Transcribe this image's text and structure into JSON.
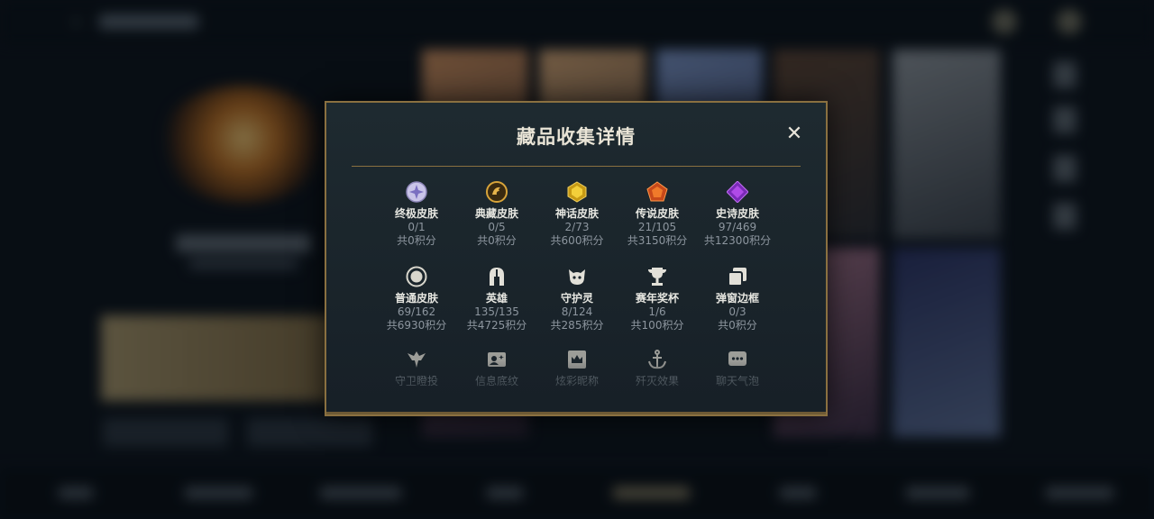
{
  "modal": {
    "title": "藏品收集详情",
    "close_label": "✕",
    "items": [
      {
        "name": "终极皮肤",
        "count": "0/1",
        "score": "共0积分",
        "icon": "ultimate-skin-icon"
      },
      {
        "name": "典藏皮肤",
        "count": "0/5",
        "score": "共0积分",
        "icon": "mythic-dragon-icon"
      },
      {
        "name": "神话皮肤",
        "count": "2/73",
        "score": "共600积分",
        "icon": "mythic-gem-icon"
      },
      {
        "name": "传说皮肤",
        "count": "21/105",
        "score": "共3150积分",
        "icon": "legendary-gem-icon"
      },
      {
        "name": "史诗皮肤",
        "count": "97/469",
        "score": "共12300积分",
        "icon": "epic-gem-icon"
      },
      {
        "name": "普通皮肤",
        "count": "69/162",
        "score": "共6930积分",
        "icon": "common-circle-icon"
      },
      {
        "name": "英雄",
        "count": "135/135",
        "score": "共4725积分",
        "icon": "helmet-icon"
      },
      {
        "name": "守护灵",
        "count": "8/124",
        "score": "共285积分",
        "icon": "guardian-icon"
      },
      {
        "name": "赛年奖杯",
        "count": "1/6",
        "score": "共100积分",
        "icon": "trophy-icon"
      },
      {
        "name": "弹窗边框",
        "count": "0/3",
        "score": "共0积分",
        "icon": "frame-icon"
      },
      {
        "name": "守卫瞪投",
        "icon": "ward-icon"
      },
      {
        "name": "信息底纹",
        "icon": "info-card-icon"
      },
      {
        "name": "炫彩昵称",
        "icon": "crown-card-icon"
      },
      {
        "name": "歼灭效果",
        "icon": "anchor-icon"
      },
      {
        "name": "聊天气泡",
        "icon": "chat-bubble-icon"
      }
    ]
  },
  "colors": {
    "accent_gold": "#8a7040",
    "panel_bg": "#1b252c",
    "text_primary": "#e6e6e0",
    "text_secondary": "#8d969f"
  }
}
